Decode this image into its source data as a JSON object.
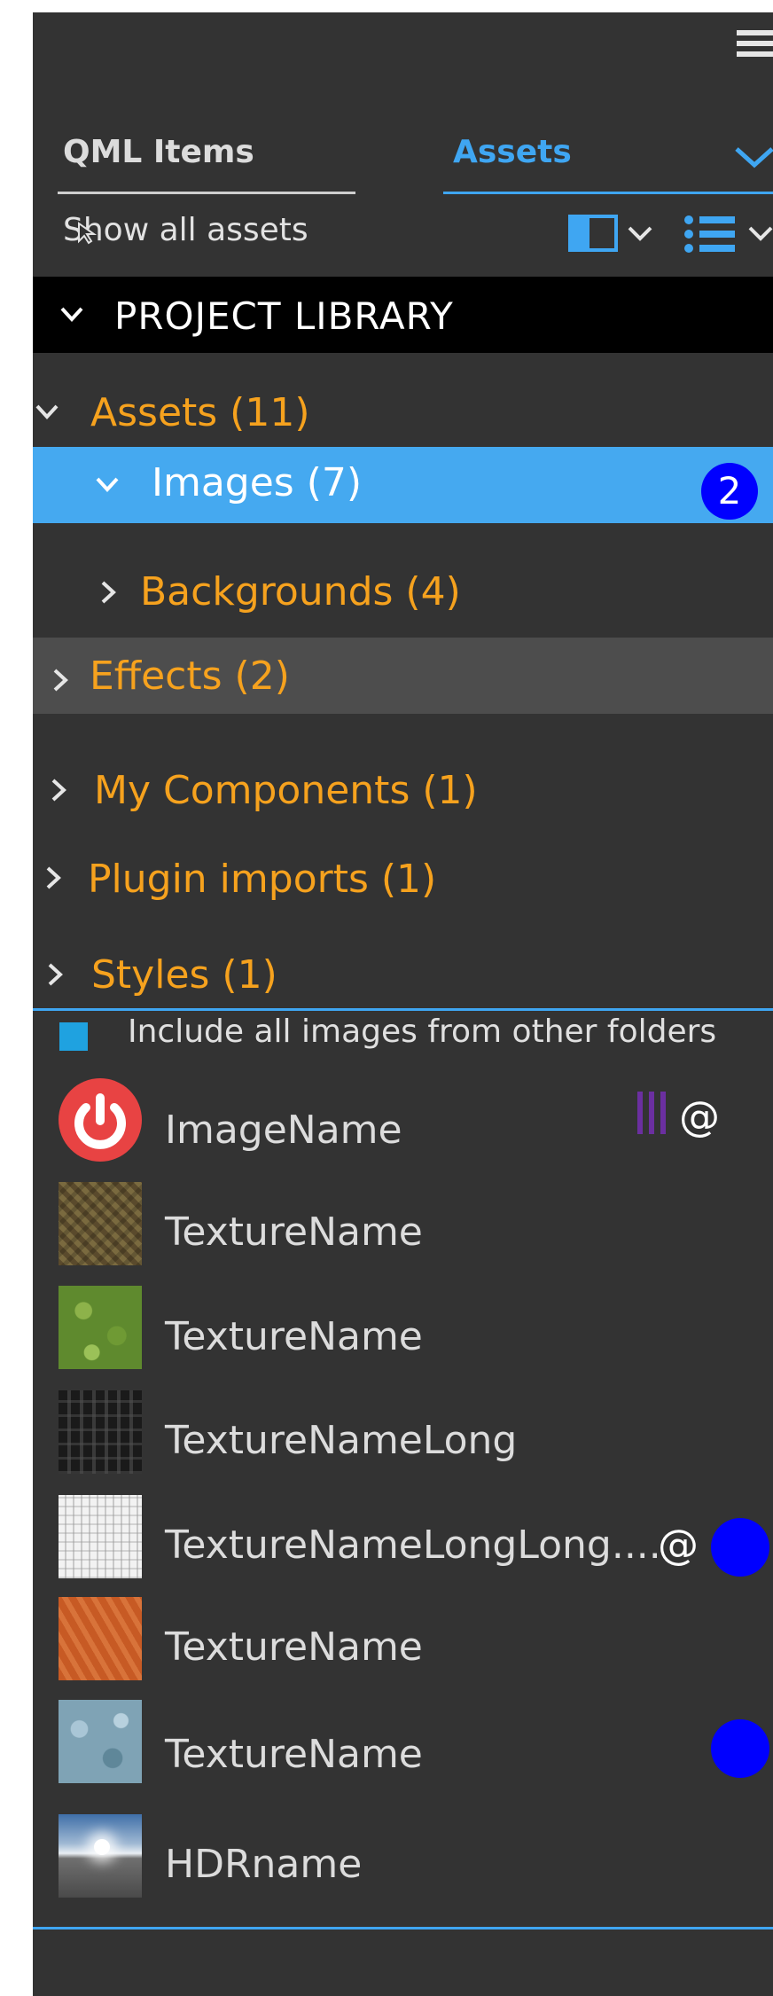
{
  "tabs": [
    {
      "label": "QML Items",
      "active": false
    },
    {
      "label": "Assets",
      "active": true
    }
  ],
  "filter": {
    "label": "Show all assets"
  },
  "library": {
    "title": "PROJECT  LIBRARY"
  },
  "tree": {
    "assets": "Assets (11)",
    "images": "Images (7)",
    "images_badge": "2",
    "backgrounds": "Backgrounds (4)",
    "effects": "Effects (2)",
    "my_components": "My Components (1)",
    "plugin_imports": "Plugin imports (1)",
    "styles": "Styles (1)"
  },
  "include_label": "Include all images  from other folders",
  "assets_list": [
    {
      "name": "ImageName",
      "thumb": "power-icon",
      "markers": "purple-bars + @"
    },
    {
      "name": "TextureName",
      "thumb": "scale-texture"
    },
    {
      "name": "TextureName",
      "thumb": "grass-texture"
    },
    {
      "name": "TextureNameLong",
      "thumb": "dark-maze-texture"
    },
    {
      "name": "TextureNameLongLong....",
      "thumb": "white-pattern-texture",
      "markers": "@ + blue-dot"
    },
    {
      "name": "TextureName",
      "thumb": "orange-wood-texture"
    },
    {
      "name": "TextureName",
      "thumb": "blue-stone-texture",
      "markers": "blue-dot"
    },
    {
      "name": "HDRname",
      "thumb": "hdr-sky-image"
    }
  ],
  "markers": {
    "at_symbol": "@"
  },
  "colors": {
    "panel": "#333333",
    "accent": "#3fa6f2",
    "orange": "#f6a21e",
    "selected_row": "#45a9f0",
    "badge": "#0000ff",
    "purple_marker": "#6b2fa0"
  }
}
